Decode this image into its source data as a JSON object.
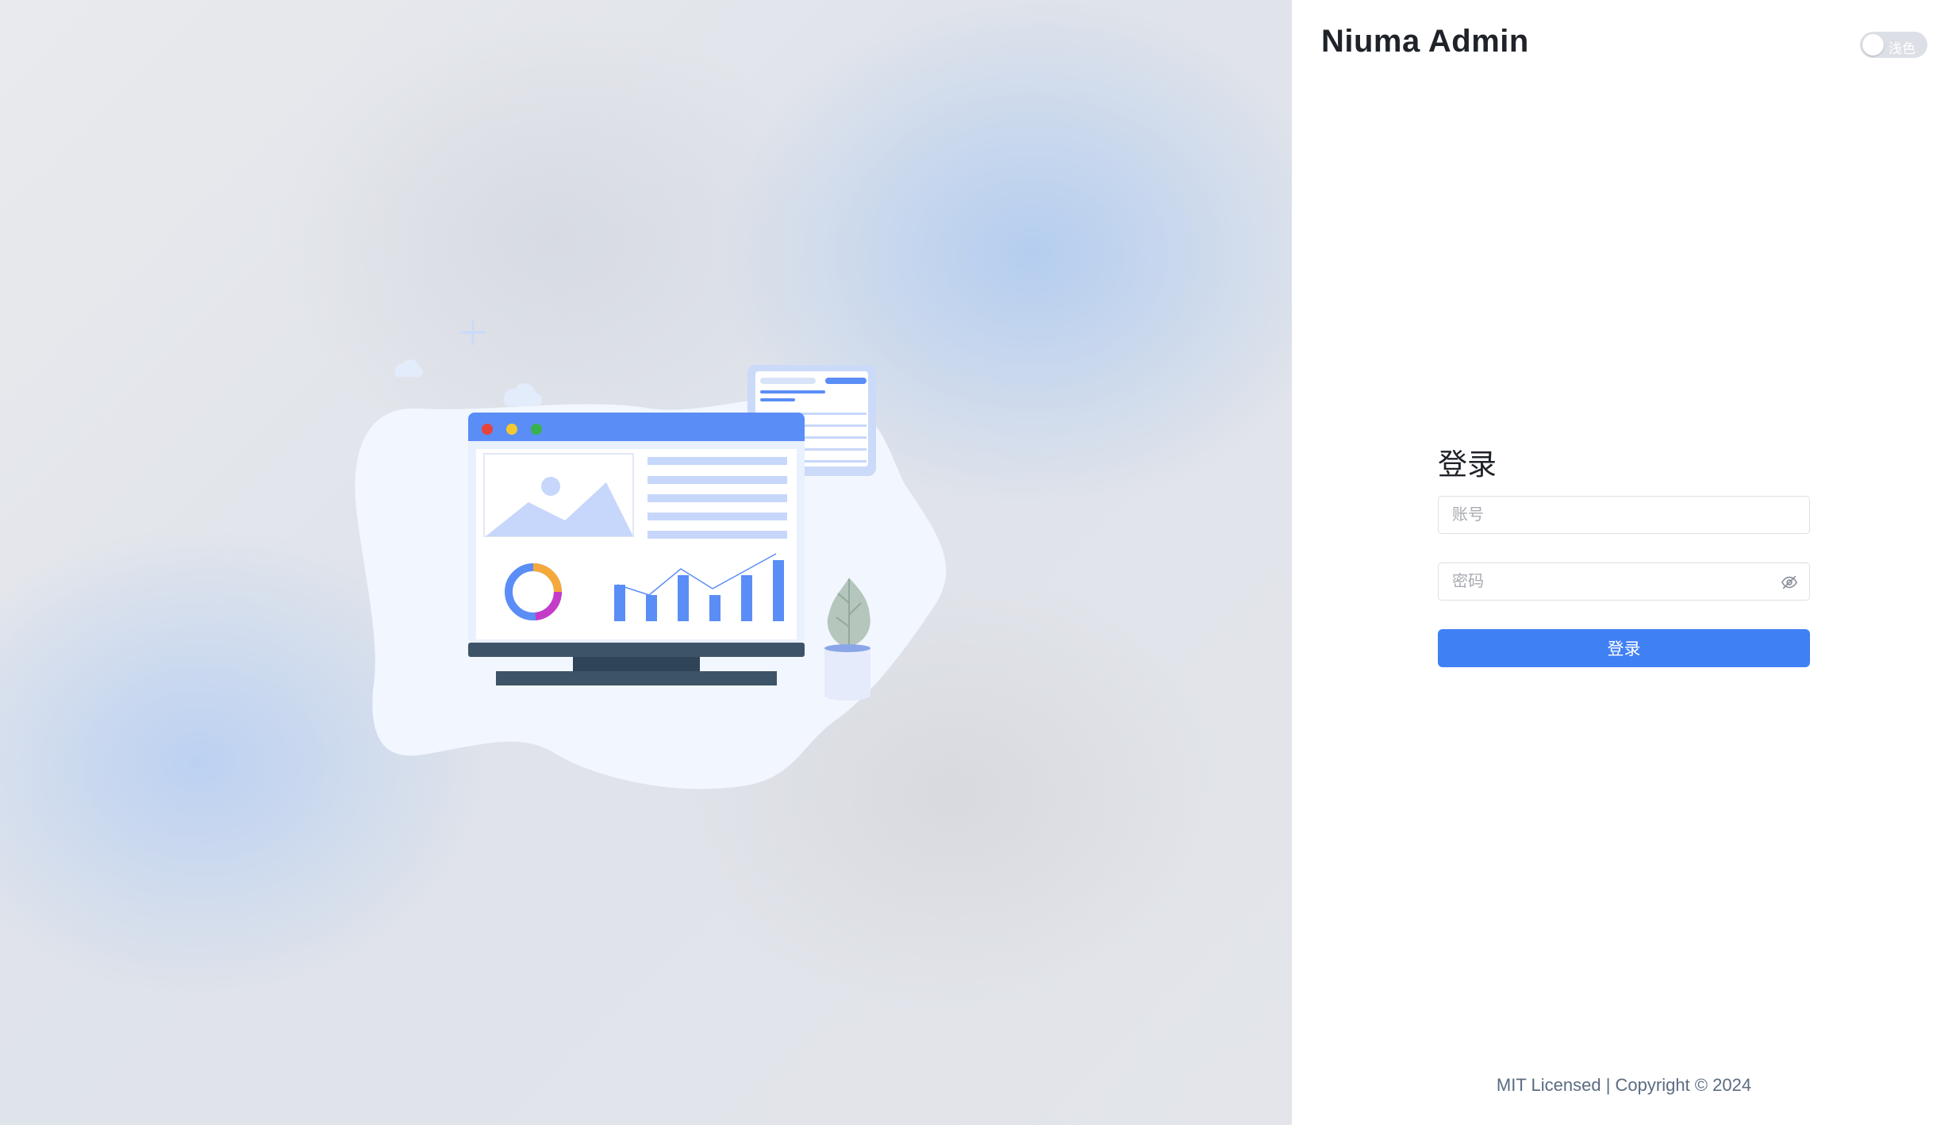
{
  "app": {
    "title": "Niuma Admin"
  },
  "theme_toggle": {
    "label": "浅色",
    "checked": false
  },
  "login": {
    "heading": "登录",
    "username": {
      "placeholder": "账号",
      "value": ""
    },
    "password": {
      "placeholder": "密码",
      "value": ""
    },
    "submit_label": "登录"
  },
  "footer": {
    "text": "MIT Licensed | Copyright © 2024"
  },
  "colors": {
    "primary": "#4080f5",
    "illustration_blue": "#5b8df6",
    "illustration_light": "#c7d7fb",
    "monitor_stand": "#3d5468"
  },
  "icons": {
    "password_toggle": "eye-off-icon"
  }
}
